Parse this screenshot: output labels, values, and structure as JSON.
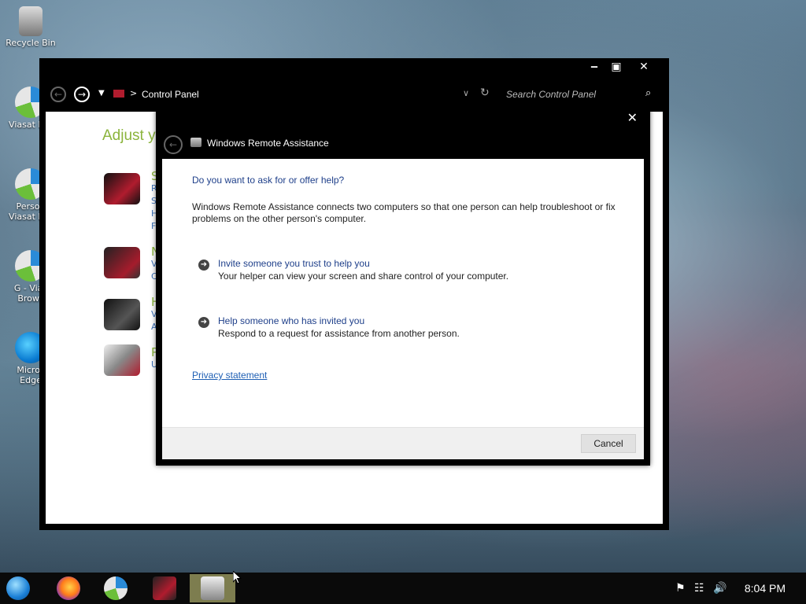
{
  "desktop": {
    "icons": [
      {
        "label": "Recycle Bin"
      },
      {
        "label": "Viasat Bro"
      },
      {
        "label": "Person"
      },
      {
        "label": "Viasat Bro"
      },
      {
        "label": "G - Vias"
      },
      {
        "label": "Brows"
      },
      {
        "label": "Micros"
      },
      {
        "label": "Edge"
      }
    ]
  },
  "control_panel": {
    "breadcrumb": "Control Panel",
    "search_placeholder": "Search Control Panel",
    "heading": "Adjust y",
    "categories": [
      {
        "letters": [
          "S",
          "R",
          "S",
          "H",
          "F"
        ]
      },
      {
        "letters": [
          "N",
          "V",
          "C"
        ]
      },
      {
        "letters": [
          "H",
          "V",
          "A"
        ]
      },
      {
        "letters": [
          "P",
          "U"
        ]
      }
    ]
  },
  "dialog": {
    "title": "Windows Remote Assistance",
    "question": "Do you want to ask for or offer help?",
    "description": "Windows Remote Assistance connects two computers so that one person can help troubleshoot or fix problems on the other person's computer.",
    "options": [
      {
        "title": "Invite someone you trust to help you",
        "subtitle": "Your helper can view your screen and share control of your computer."
      },
      {
        "title": "Help someone who has invited you",
        "subtitle": "Respond to a request for assistance from another person."
      }
    ],
    "privacy_link": "Privacy statement",
    "cancel_label": "Cancel"
  },
  "taskbar": {
    "clock": "8:04 PM"
  },
  "colors": {
    "heading_green": "#8bb43c",
    "link_blue": "#1e5fb4",
    "title_blue": "#1e3f8a",
    "taskbar_active": "#7d7d4f"
  }
}
